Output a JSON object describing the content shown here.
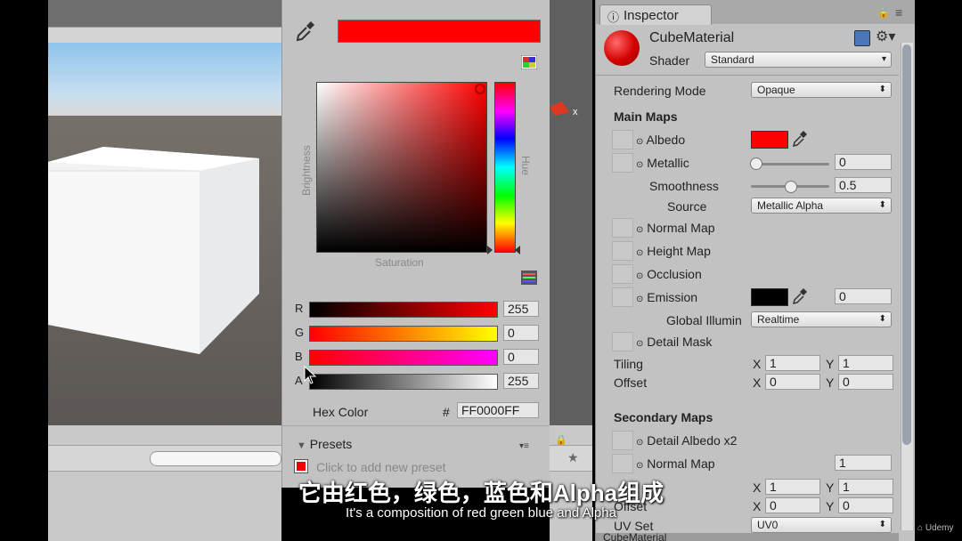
{
  "picker": {
    "brightness_label": "Brightness",
    "saturation_label": "Saturation",
    "hue_label": "Hue",
    "color_hex": "#ff0000",
    "channels": [
      {
        "label": "R",
        "value": "255"
      },
      {
        "label": "G",
        "value": "0"
      },
      {
        "label": "B",
        "value": "0"
      },
      {
        "label": "A",
        "value": "255"
      }
    ],
    "hex_label": "Hex Color",
    "hash": "#",
    "hex_value": "FF0000FF",
    "presets_label": "Presets",
    "add_preset": "Click to add new preset"
  },
  "inspector": {
    "tab_label": "Inspector",
    "material_name": "CubeMaterial",
    "shader_label": "Shader",
    "shader_value": "Standard",
    "rendering_mode_label": "Rendering Mode",
    "rendering_mode_value": "Opaque",
    "main_maps_label": "Main Maps",
    "albedo_label": "Albedo",
    "metallic_label": "Metallic",
    "metallic_value": "0",
    "smoothness_label": "Smoothness",
    "smoothness_value": "0.5",
    "source_label": "Source",
    "source_value": "Metallic Alpha",
    "normal_map_label": "Normal Map",
    "height_map_label": "Height Map",
    "occlusion_label": "Occlusion",
    "emission_label": "Emission",
    "emission_value": "0",
    "global_illum_label": "Global Illumin",
    "global_illum_value": "Realtime",
    "detail_mask_label": "Detail Mask",
    "tiling_label": "Tiling",
    "offset_label": "Offset",
    "x_label": "X",
    "y_label": "Y",
    "tiling_x": "1",
    "tiling_y": "1",
    "offset_x": "0",
    "offset_y": "0",
    "secondary_maps_label": "Secondary Maps",
    "detail_albedo_label": "Detail Albedo x2",
    "sec_normal_map_label": "Normal Map",
    "sec_normal_value": "1",
    "sec_offset_label": "Offset",
    "sec_tiling_x": "1",
    "sec_tiling_y": "1",
    "sec_offset_x": "0",
    "sec_offset_y": "0",
    "uv_set_label": "UV Set",
    "uv_set_value": "UV0",
    "bottom_label": "CubeMaterial"
  },
  "scene": {
    "gizmo_axis": "x"
  },
  "watermark": "Udemy",
  "subtitle": {
    "zh": "它由红色，绿色，蓝色和Alpha组成",
    "en": "It's a composition of red green blue and Alpha"
  },
  "colors": {
    "accent_red": "#ff0000",
    "emission": "#000000"
  }
}
